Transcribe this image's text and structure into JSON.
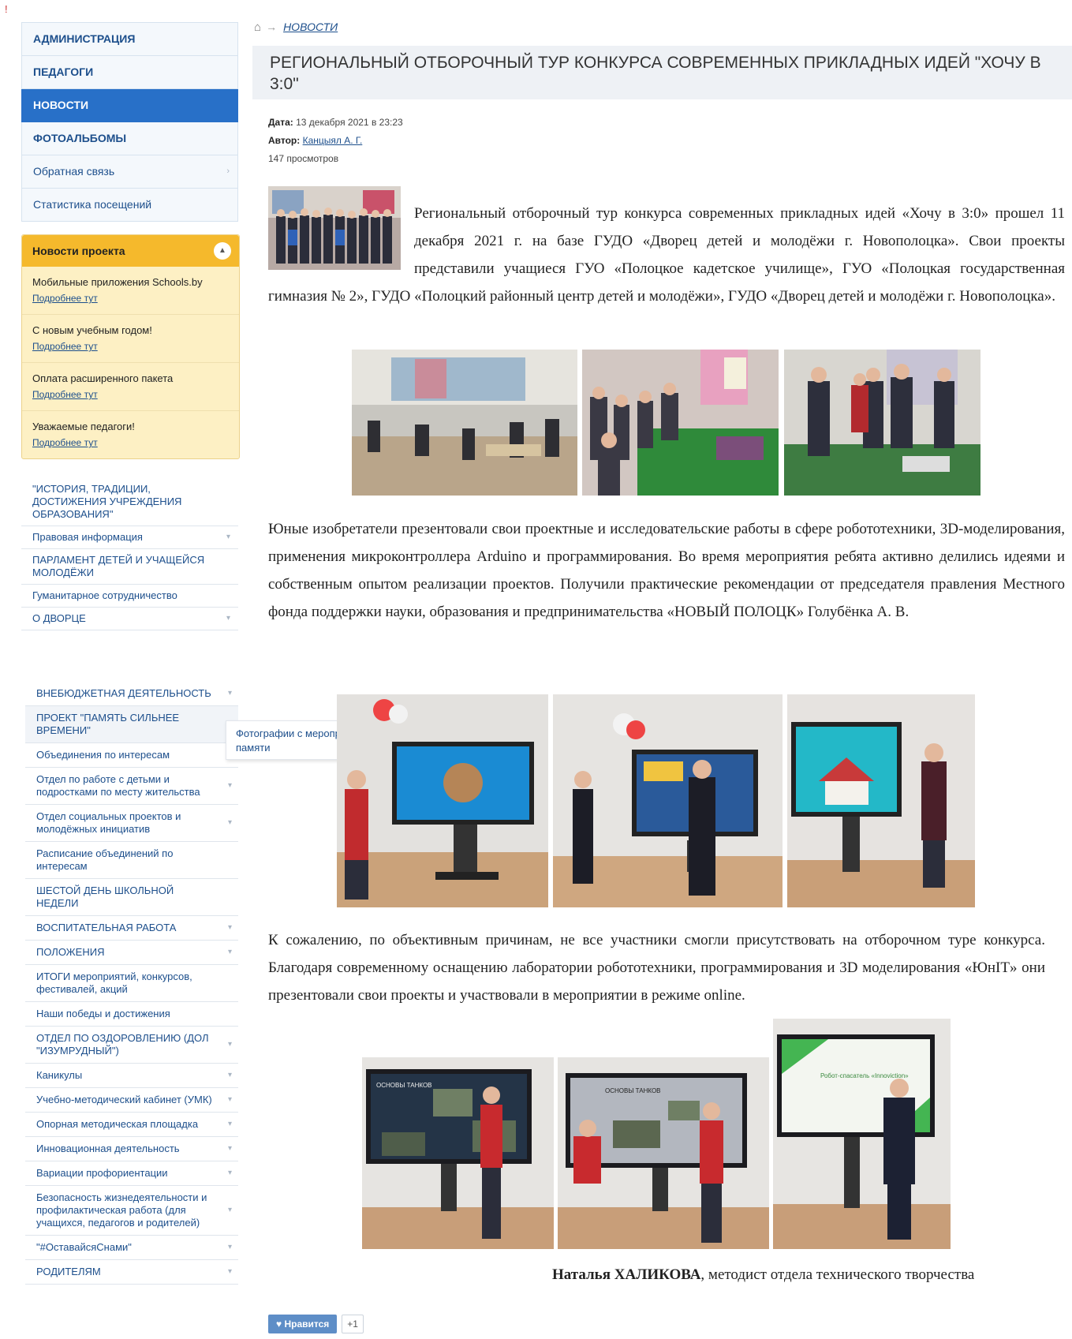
{
  "marker": "!",
  "sidebar_top": [
    {
      "label": "АДМИНИСТРАЦИЯ",
      "active": false,
      "arrow": false
    },
    {
      "label": "ПЕДАГОГИ",
      "active": false,
      "arrow": false
    },
    {
      "label": "НОВОСТИ",
      "active": true,
      "arrow": false
    },
    {
      "label": "ФОТОАЛЬБОМЫ",
      "active": false,
      "arrow": false
    },
    {
      "label": "Обратная связь",
      "active": false,
      "arrow": true
    },
    {
      "label": "Статистика посещений",
      "active": false,
      "arrow": false
    }
  ],
  "project_news": {
    "title": "Новости проекта",
    "items": [
      {
        "text": "Мобильные приложения Schools.by",
        "link": "Подробнее тут"
      },
      {
        "text": "С новым учебным годом!",
        "link": "Подробнее тут"
      },
      {
        "text": "Оплата расширенного пакета",
        "link": "Подробнее тут"
      },
      {
        "text": "Уважаемые педагоги!",
        "link": "Подробнее тут"
      }
    ]
  },
  "sidebar_mid": [
    {
      "label": "\"ИСТОРИЯ, ТРАДИЦИИ, ДОСТИЖЕНИЯ УЧРЕЖДЕНИЯ ОБРАЗОВАНИЯ\"",
      "arrow": false
    },
    {
      "label": "Правовая информация",
      "arrow": true
    },
    {
      "label": "ПАРЛАМЕНТ ДЕТЕЙ И УЧАЩЕЙСЯ МОЛОДЁЖИ",
      "arrow": false
    },
    {
      "label": "Гуманитарное сотрудничество",
      "arrow": false
    },
    {
      "label": "О ДВОРЦЕ",
      "arrow": true
    }
  ],
  "sidebar_bottom": [
    {
      "label": "ВНЕБЮДЖЕТНАЯ ДЕЯТЕЛЬНОСТЬ",
      "arrow": true
    },
    {
      "label": "ПРОЕКТ \"ПАМЯТЬ СИЛЬНЕЕ ВРЕМЕНИ\"",
      "arrow": false,
      "highlight": true
    },
    {
      "label": "Объединения по интересам",
      "arrow": true
    },
    {
      "label": "Отдел по работе с детьми и подростками по месту жительства",
      "arrow": true
    },
    {
      "label": "Отдел социальных проектов и молодёжных инициатив",
      "arrow": true
    },
    {
      "label": "Расписание объединений по интересам",
      "arrow": false
    },
    {
      "label": "ШЕСТОЙ ДЕНЬ ШКОЛЬНОЙ НЕДЕЛИ",
      "arrow": false
    },
    {
      "label": "ВОСПИТАТЕЛЬНАЯ РАБОТА",
      "arrow": true
    },
    {
      "label": "ПОЛОЖЕНИЯ",
      "arrow": true
    },
    {
      "label": "ИТОГИ мероприятий, конкурсов, фестивалей, акций",
      "arrow": false
    },
    {
      "label": "Наши победы и достижения",
      "arrow": false
    },
    {
      "label": "ОТДЕЛ ПО ОЗДОРОВЛЕНИЮ (ДОЛ \"ИЗУМРУДНЫЙ\")",
      "arrow": true
    },
    {
      "label": "Каникулы",
      "arrow": true
    },
    {
      "label": "Учебно-методический кабинет (УМК)",
      "arrow": true
    },
    {
      "label": "Опорная методическая площадка",
      "arrow": true
    },
    {
      "label": "Инновационная деятельность",
      "arrow": true
    },
    {
      "label": "Вариации профориентации",
      "arrow": true
    },
    {
      "label": "Безопасность жизнедеятельности и профилактическая работа (для учащихся, педагогов и родителей)",
      "arrow": true
    },
    {
      "label": "\"#ОставайсяСнами\"",
      "arrow": true
    },
    {
      "label": "РОДИТЕЛЯМ",
      "arrow": true
    }
  ],
  "submenu_popup": "Фотографии с мероприятий Года исторической памяти",
  "breadcrumb": {
    "link": "НОВОСТИ"
  },
  "article": {
    "title": "РЕГИОНАЛЬНЫЙ ОТБОРОЧНЫЙ ТУР КОНКУРСА СОВРЕМЕННЫХ ПРИКЛАДНЫХ ИДЕЙ \"ХОЧУ В 3:0\"",
    "date_label": "Дата:",
    "date": "13 декабря 2021 в 23:23",
    "author_label": "Автор:",
    "author": "Канцыял А. Г.",
    "views": "147 просмотров",
    "p1": "Региональный отборочный тур конкурса современных прикладных идей «Хочу в 3:0» прошел 11 декабря 2021 г. на базе ГУДО «Дворец детей и молодёжи г. Новополоцка». Свои проекты представили учащиеся ГУО «Полоцкое кадетское училище», ГУО «Полоцкая государственная гимназия № 2», ГУДО «Полоцкий районный центр детей и молодёжи», ГУДО «Дворец детей и молодёжи г. Новополоцка».",
    "p2": "Юные изобретатели презентовали свои проектные и исследовательские работы в сфере робототехники, 3D-моделирования, применения микроконтроллера Arduino и программирования. Во время мероприятия ребята активно делились идеями и собственным опытом реализации проектов. Получили практические рекомендации от председателя правления Местного фонда поддержки науки, образования и предпринимательства «НОВЫЙ ПОЛОЦК» Голубёнка А. В.",
    "p3": "К сожалению, по объективным причинам, не все участники смогли присутствовать на отборочном туре конкурса. Благодаря современному оснащению лаборатории робототехники, программирования и 3D моделирования «ЮнIT» они презентовали свои проекты и участвовали в мероприятии в режиме online.",
    "sign_name": "Наталья ХАЛИКОВА",
    "sign_rest": ", методист отдела технического творчества"
  },
  "photo_texts": {
    "slide_c1": "ОСНОВЫ ТАНКОВ",
    "slide_c2": "ОСНОВЫ ТАНКОВ",
    "slide_c3": "Робот-спасатель «Innoviction»"
  },
  "like": {
    "label": "Нравится",
    "count": "+1"
  },
  "colors": {
    "accent": "#2870c8",
    "news_header": "#f5b92c",
    "news_bg": "#fdf0c4",
    "link": "#1d4f8c"
  }
}
